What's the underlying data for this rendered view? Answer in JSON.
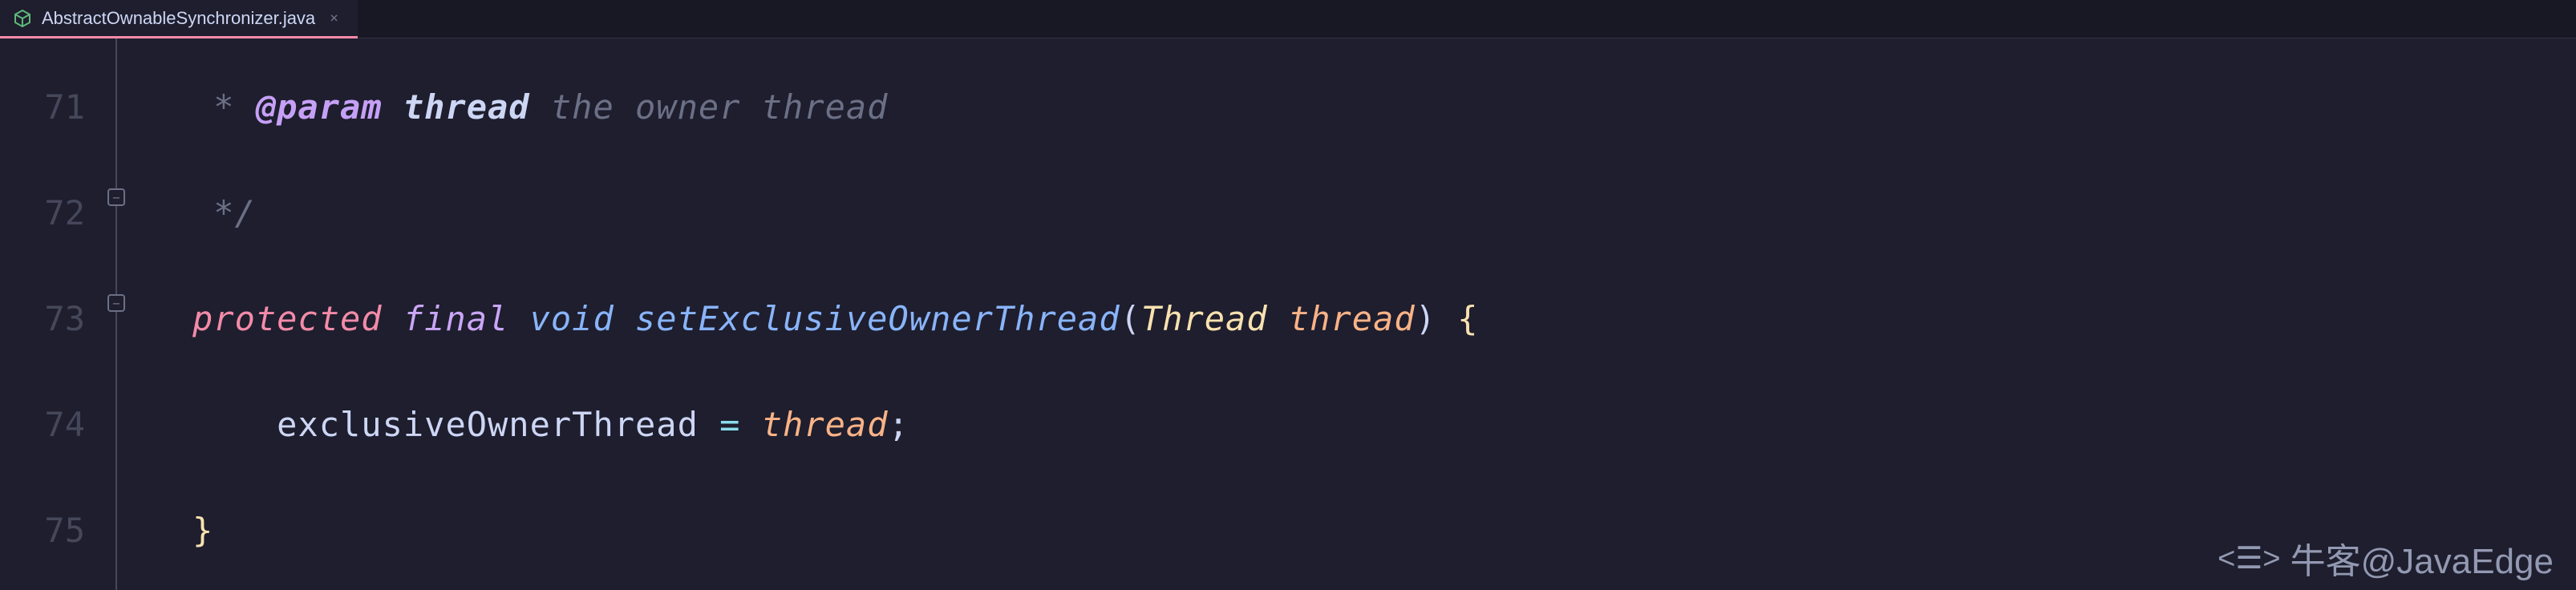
{
  "tab": {
    "filename": "AbstractOwnableSynchronizer.java",
    "close_glyph": "×"
  },
  "lines": {
    "l71": {
      "number": "71",
      "comment_prefix": " * ",
      "param_tag": "@param",
      "param_name": " thread",
      "comment_rest": " the owner thread"
    },
    "l72": {
      "number": "72",
      "text": " */"
    },
    "l73": {
      "number": "73",
      "kw_protected": "protected",
      "kw_final": " final",
      "kw_void": " void",
      "method": " setExclusiveOwnerThread",
      "paren_open": "(",
      "type": "Thread ",
      "param": "thread",
      "paren_close": ")",
      "brace": " {"
    },
    "l74": {
      "number": "74",
      "indent": "    ",
      "lhs": "exclusiveOwnerThread ",
      "op": "=",
      "rhs_space": " ",
      "rhs": "thread",
      "semi": ";"
    },
    "l75": {
      "number": "75",
      "brace": "}"
    }
  },
  "fold": {
    "collapse_glyph": "−"
  },
  "watermark": {
    "text": "牛客@JavaEdge"
  }
}
